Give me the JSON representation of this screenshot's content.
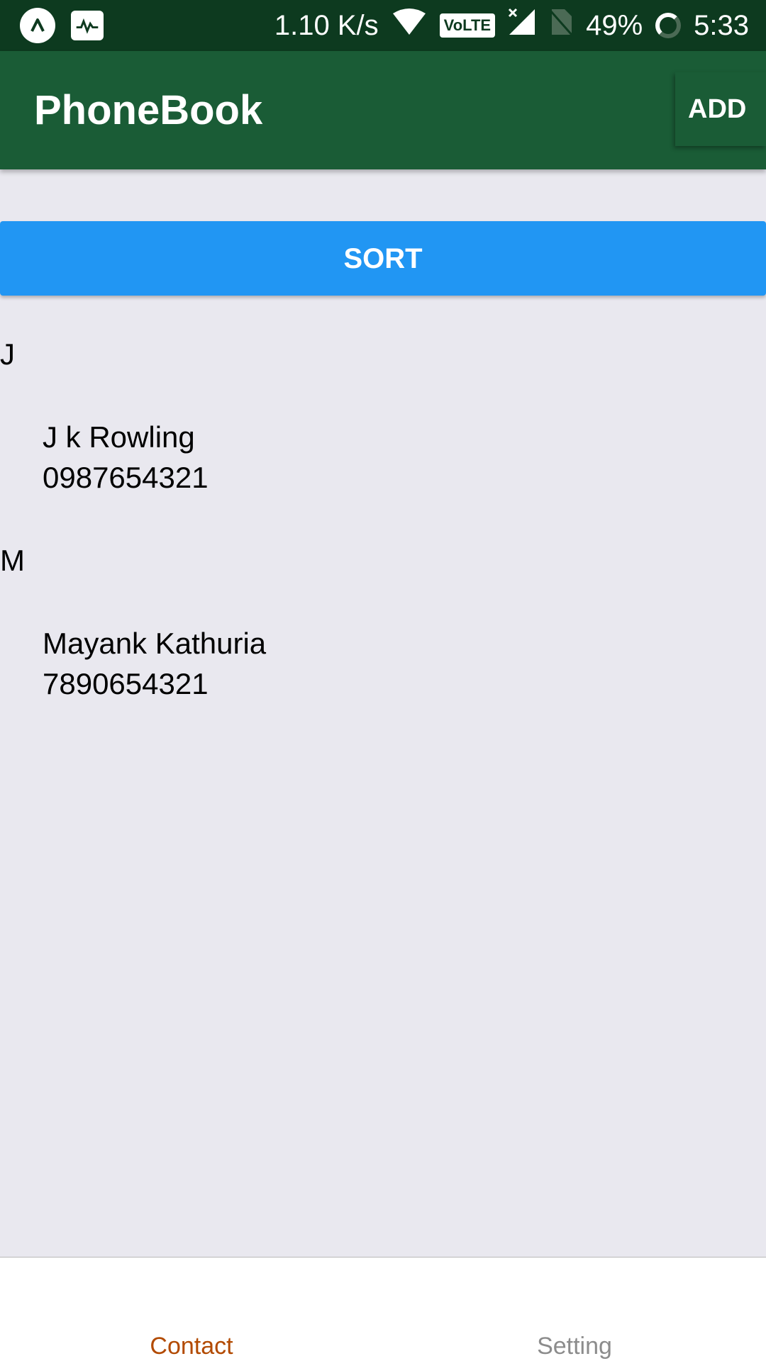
{
  "status_bar": {
    "net_speed": "1.10 K/s",
    "volte": "VoLTE",
    "battery": "49%",
    "time": "5:33",
    "icons": [
      "app-logo-icon",
      "activity-monitor-icon",
      "wifi-icon",
      "signal-icon",
      "no-sim-icon",
      "battery-ring-icon"
    ]
  },
  "app_bar": {
    "title": "PhoneBook",
    "add_label": "ADD"
  },
  "sort_button": {
    "label": "SORT"
  },
  "contacts": {
    "sections": [
      {
        "letter": "J",
        "items": [
          {
            "name": "J k Rowling",
            "phone": "0987654321"
          }
        ]
      },
      {
        "letter": "M",
        "items": [
          {
            "name": "Mayank Kathuria",
            "phone": "7890654321"
          }
        ]
      }
    ]
  },
  "tabs": [
    {
      "label": "Contact",
      "active": true
    },
    {
      "label": "Setting",
      "active": false
    }
  ],
  "colors": {
    "status_bar": "#0d3a1f",
    "app_bar": "#1a5c36",
    "sort_button": "#2196f3",
    "background": "#e9e8ef",
    "tab_active": "#b24a00",
    "tab_inactive": "#8c8c8c"
  }
}
